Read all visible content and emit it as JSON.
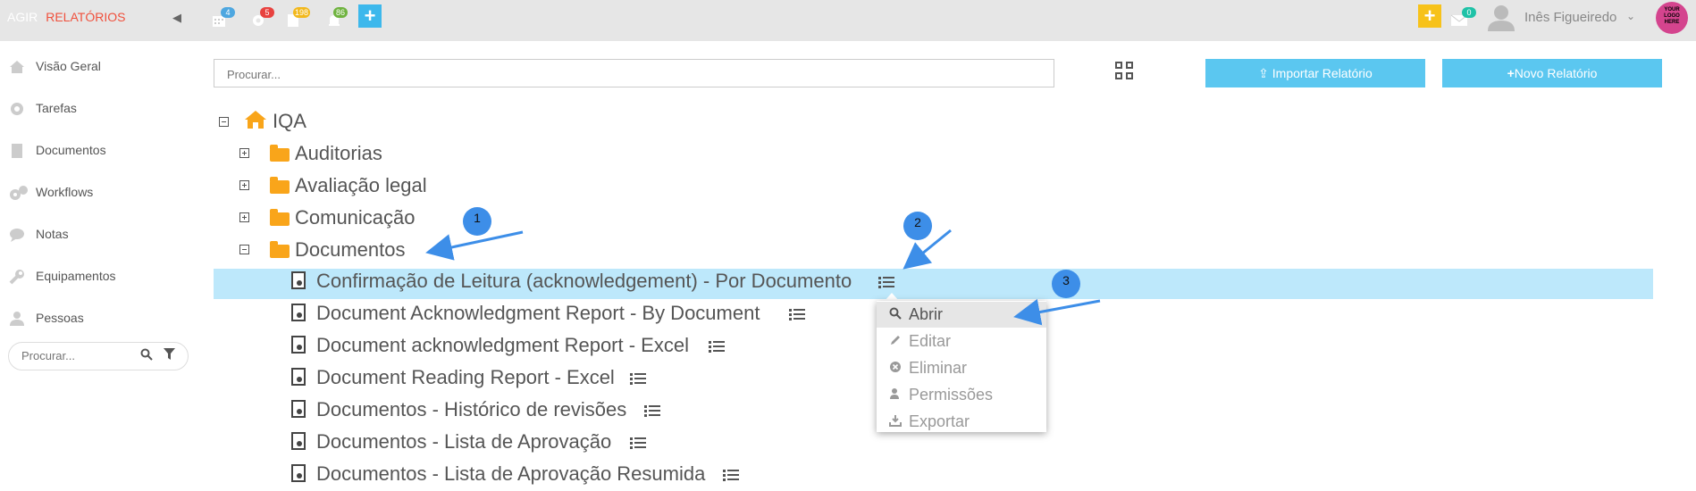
{
  "topbar": {
    "app_name": "AGIR",
    "module": "RELATÓRIOS",
    "collapse_icon": "caret-left-icon",
    "notifications": [
      {
        "icon": "calendar-icon",
        "badge": "4",
        "badge_color": "#4ea7e0"
      },
      {
        "icon": "gear-icon",
        "badge": "5",
        "badge_color": "#e8423f"
      },
      {
        "icon": "document-icon",
        "badge": "198",
        "badge_color": "#f2b81c"
      },
      {
        "icon": "bell-icon",
        "badge": "86",
        "badge_color": "#6fb33f"
      }
    ],
    "add_icon": "plus-icon",
    "right_add_icon": "plus-icon",
    "mail_badge": "0",
    "user_name": "Inês Figueiredo",
    "logo_text": "YOUR LOGO HERE",
    "colors": {
      "bar": "#e6e6e6",
      "module": "#f0503c",
      "add_blue": "#3db8ec",
      "add_yellow": "#f7c21a",
      "mail_badge": "#1fc2a7"
    }
  },
  "sidebar": {
    "items": [
      {
        "label": "Visão Geral",
        "icon": "home-icon"
      },
      {
        "label": "Tarefas",
        "icon": "gear-icon"
      },
      {
        "label": "Documentos",
        "icon": "document-icon"
      },
      {
        "label": "Workflows",
        "icon": "gears-icon"
      },
      {
        "label": "Notas",
        "icon": "comments-icon"
      },
      {
        "label": "Equipamentos",
        "icon": "wrench-icon"
      },
      {
        "label": "Pessoas",
        "icon": "user-icon"
      }
    ],
    "search_placeholder": "Procurar..."
  },
  "main": {
    "search_placeholder": "Procurar...",
    "import_button": "Importar Relatório",
    "new_button": "Novo Relatório",
    "accent": "#5bc7f0"
  },
  "tree": {
    "root": "IQA",
    "folders": [
      {
        "label": "Auditorias",
        "expanded": false
      },
      {
        "label": "Avaliação legal",
        "expanded": false
      },
      {
        "label": "Comunicação",
        "expanded": false
      },
      {
        "label": "Documentos",
        "expanded": true
      }
    ],
    "reports": [
      {
        "label": "Confirmação de Leitura (acknowledgement) - Por Documento",
        "selected": true
      },
      {
        "label": "Document Acknowledgment Report - By Document"
      },
      {
        "label": "Document acknowledgment Report - Excel"
      },
      {
        "label": "Document Reading Report - Excel"
      },
      {
        "label": "Documentos - Histórico de revisões"
      },
      {
        "label": "Documentos - Lista de Aprovação"
      },
      {
        "label": "Documentos - Lista de Aprovação Resumida"
      }
    ]
  },
  "context_menu": {
    "items": [
      {
        "label": "Abrir",
        "icon": "search-icon"
      },
      {
        "label": "Editar",
        "icon": "pencil-icon"
      },
      {
        "label": "Eliminar",
        "icon": "close-circle-icon"
      },
      {
        "label": "Permissões",
        "icon": "users-icon"
      },
      {
        "label": "Exportar",
        "icon": "download-icon"
      }
    ]
  },
  "annotations": [
    "1",
    "2",
    "3"
  ]
}
